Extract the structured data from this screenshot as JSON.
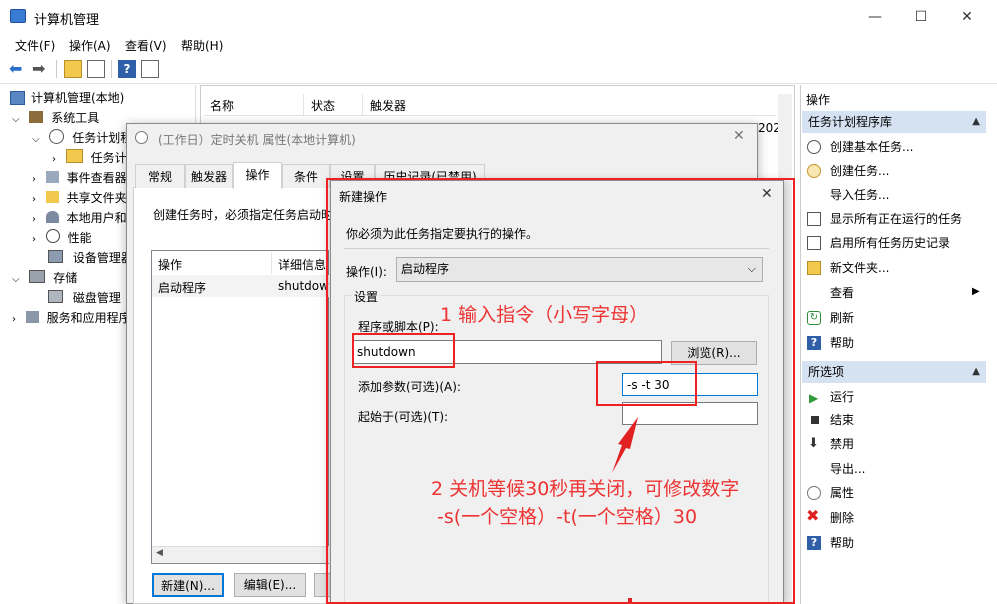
{
  "window": {
    "title": "计算机管理",
    "min": "—",
    "max": "☐",
    "close": "✕"
  },
  "menu": [
    "文件(F)",
    "操作(A)",
    "查看(V)",
    "帮助(H)"
  ],
  "tree": {
    "root": "计算机管理(本地)",
    "system_tools": "系统工具",
    "task_scheduler": "任务计划程",
    "task_scheduler_lib": "任务计",
    "event_viewer": "事件查看器",
    "shared_folders": "共享文件夹",
    "local_users": "本地用户和",
    "performance": "性能",
    "device_manager": "设备管理器",
    "storage": "存储",
    "disk_mgmt": "磁盘管理",
    "services_apps": "服务和应用程序"
  },
  "list": {
    "headers": [
      "名称",
      "状态",
      "触发器"
    ],
    "row_fragment": "202"
  },
  "actions": {
    "header": "操作",
    "section1": "任务计划程序库",
    "items1": [
      "创建基本任务...",
      "创建任务...",
      "导入任务...",
      "显示所有正在运行的任务",
      "启用所有任务历史记录",
      "新文件夹...",
      "查看",
      "刷新",
      "帮助"
    ],
    "section2": "所选项",
    "items2": [
      "运行",
      "结束",
      "禁用",
      "导出...",
      "属性",
      "删除",
      "帮助"
    ]
  },
  "props": {
    "title": "(工作日）定时关机 属性(本地计算机)",
    "tabs": [
      "常规",
      "触发器",
      "操作",
      "条件",
      "设置",
      "历史记录(已禁用)"
    ],
    "desc": "创建任务时，必须指定任务启动时",
    "table_headers": [
      "操作",
      "详细信息"
    ],
    "row": [
      "启动程序",
      "shutdow"
    ],
    "buttons": [
      "新建(N)...",
      "编辑(E)..."
    ]
  },
  "newaction": {
    "title": "新建操作",
    "desc": "你必须为此任务指定要执行的操作。",
    "action_label": "操作(I):",
    "action_value": "启动程序",
    "settings_label": "设置",
    "program_label": "程序或脚本(P):",
    "program_value": "shutdown",
    "browse": "浏览(R)...",
    "args_label": "添加参数(可选)(A):",
    "args_value": "-s -t 30",
    "startin_label": "起始于(可选)(T):",
    "startin_value": ""
  },
  "annotations": {
    "note1": "1 输入指令（小写字母）",
    "note2_line1": "2 关机等候30秒再关闭，可修改数字",
    "note2_line2": "-s(一个空格）-t(一个空格）30"
  },
  "colors": {
    "annotation": "#e22222",
    "section_header": "#d5e2f1",
    "accent": "#0066cc"
  }
}
